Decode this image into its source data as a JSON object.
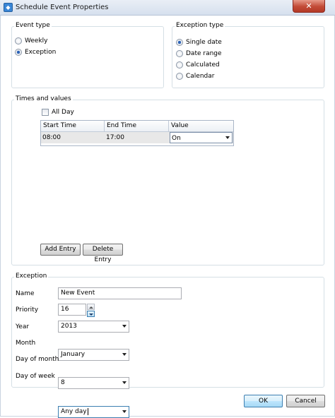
{
  "window": {
    "title": "Schedule Event Properties",
    "close_glyph": "✕",
    "icon_glyph": "◆"
  },
  "event_type": {
    "title": "Event type",
    "options": [
      {
        "label": "Weekly",
        "selected": false
      },
      {
        "label": "Exception",
        "selected": true
      }
    ]
  },
  "exception_type": {
    "title": "Exception type",
    "options": [
      {
        "label": "Single date",
        "selected": true
      },
      {
        "label": "Date range",
        "selected": false
      },
      {
        "label": "Calculated",
        "selected": false
      },
      {
        "label": "Calendar",
        "selected": false
      }
    ]
  },
  "times": {
    "title": "Times and values",
    "all_day_label": "All Day",
    "all_day_checked": false,
    "columns": [
      "Start Time",
      "End Time",
      "Value"
    ],
    "rows": [
      {
        "start": "08:00",
        "end": "17:00",
        "value": "On"
      }
    ],
    "add_label": "Add Entry",
    "delete_label": "Delete Entry"
  },
  "exception": {
    "title": "Exception",
    "name_label": "Name",
    "name_value": "New Event",
    "priority_label": "Priority",
    "priority_value": "16",
    "year_label": "Year",
    "year_value": "2013",
    "month_label": "Month",
    "month_value": "January",
    "day_of_month_label": "Day of month",
    "day_of_month_value": "8",
    "day_of_week_label": "Day of week",
    "day_of_week_value": "Any day"
  },
  "footer": {
    "ok_label": "OK",
    "cancel_label": "Cancel"
  }
}
